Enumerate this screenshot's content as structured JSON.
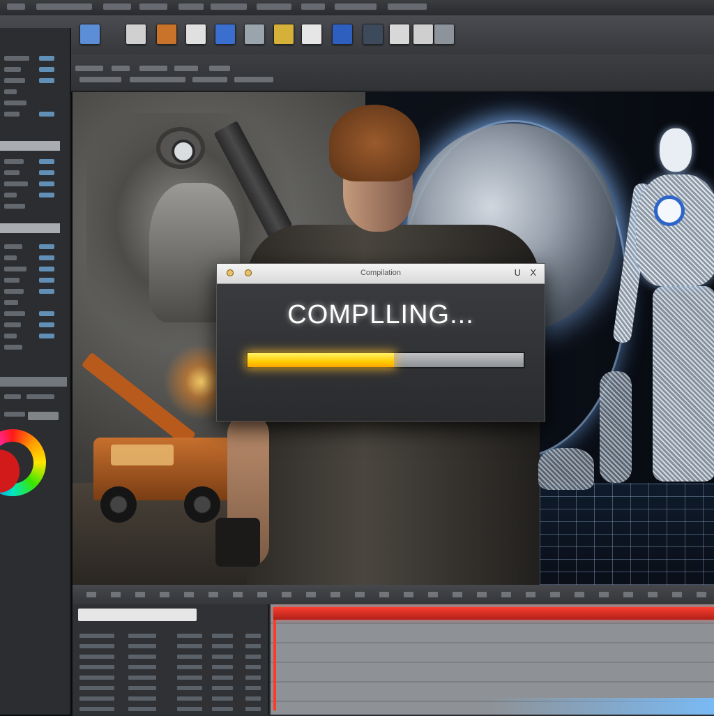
{
  "app": {
    "menu_items": [
      "",
      "",
      "",
      "",
      "",
      "",
      "",
      "",
      "",
      ""
    ]
  },
  "toolbar": {
    "tools": [
      {
        "icon": "scene-icon",
        "color": "#5b8ed6"
      },
      {
        "icon": "image-icon",
        "color": "#d0d0d0"
      },
      {
        "icon": "character-icon",
        "color": "#c9732a"
      },
      {
        "icon": "layer-icon",
        "color": "#e0e0e0"
      },
      {
        "icon": "target-icon",
        "color": "#3a6fd0"
      },
      {
        "icon": "material-icon",
        "color": "#9aa4ad"
      },
      {
        "icon": "paint-icon",
        "color": "#d6b13a"
      },
      {
        "icon": "render-icon",
        "color": "#e6e6e6"
      },
      {
        "icon": "globe-icon",
        "color": "#2e5fbf"
      },
      {
        "icon": "camera-icon",
        "color": "#3c4a5c"
      },
      {
        "icon": "file-icon",
        "color": "#d8d8d8"
      },
      {
        "icon": "shield-icon",
        "color": "#cfcfcf"
      },
      {
        "icon": "settings-icon",
        "color": "#8c939b"
      }
    ]
  },
  "dialog": {
    "title": "Compilation",
    "minimize_glyph": "U",
    "close_glyph": "X",
    "heading": "COMPLLING...",
    "progress": 0.53,
    "progress_color": "#ffcc00"
  },
  "colors": {
    "accent_playhead": "#ff3a2a",
    "panel_bg": "#2b2d30"
  }
}
